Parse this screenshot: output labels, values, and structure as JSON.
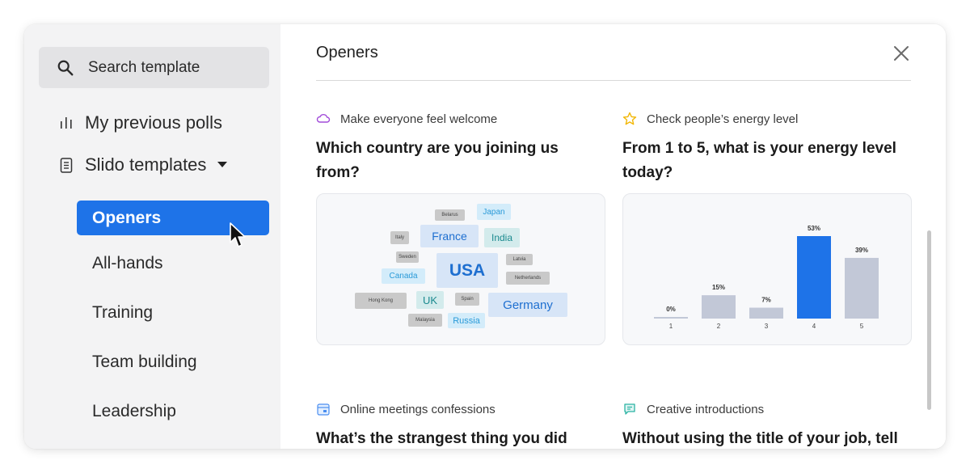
{
  "sidebar": {
    "search_label": "Search template",
    "previous_polls_label": "My previous polls",
    "templates_label": "Slido templates",
    "categories": [
      {
        "label": "Openers",
        "active": true
      },
      {
        "label": "All-hands",
        "active": false
      },
      {
        "label": "Training",
        "active": false
      },
      {
        "label": "Team building",
        "active": false
      },
      {
        "label": "Leadership",
        "active": false
      }
    ]
  },
  "main": {
    "title": "Openers",
    "cards": [
      {
        "tag": "Make everyone feel welcome",
        "tag_icon": "cloud-icon",
        "title_line1": "Which country are you joining us",
        "title_line2": "from?"
      },
      {
        "tag": "Check people’s energy level",
        "tag_icon": "star-icon",
        "title_line1": "From 1 to 5, what is your energy level",
        "title_line2": "today?"
      },
      {
        "tag": "Online meetings confessions",
        "tag_icon": "calendar-icon",
        "title_line1": "What’s the strangest thing you did",
        "title_line2": ""
      },
      {
        "tag": "Creative introductions",
        "tag_icon": "chat-icon",
        "title_line1": "Without using the title of your job, tell",
        "title_line2": ""
      }
    ],
    "word_cloud": {
      "words": [
        "Belarus",
        "Japan",
        "Italy",
        "France",
        "India",
        "Sweden",
        "USA",
        "Latvia",
        "Canada",
        "Netherlands",
        "Hong Kong",
        "UK",
        "Spain",
        "Germany",
        "Malaysia",
        "Russia"
      ]
    }
  },
  "chart_data": {
    "type": "bar",
    "categories": [
      "1",
      "2",
      "3",
      "4",
      "5"
    ],
    "values": [
      0,
      15,
      7,
      53,
      39
    ],
    "data_labels": [
      "0%",
      "15%",
      "7%",
      "53%",
      "39%"
    ],
    "highlight_index": 3,
    "colors": {
      "default": "#c2c8d7",
      "highlight": "#1e73e8"
    }
  },
  "colors": {
    "accent": "#1e73e8",
    "sidebar_bg": "#f3f3f4",
    "search_bg": "#e3e3e5"
  }
}
